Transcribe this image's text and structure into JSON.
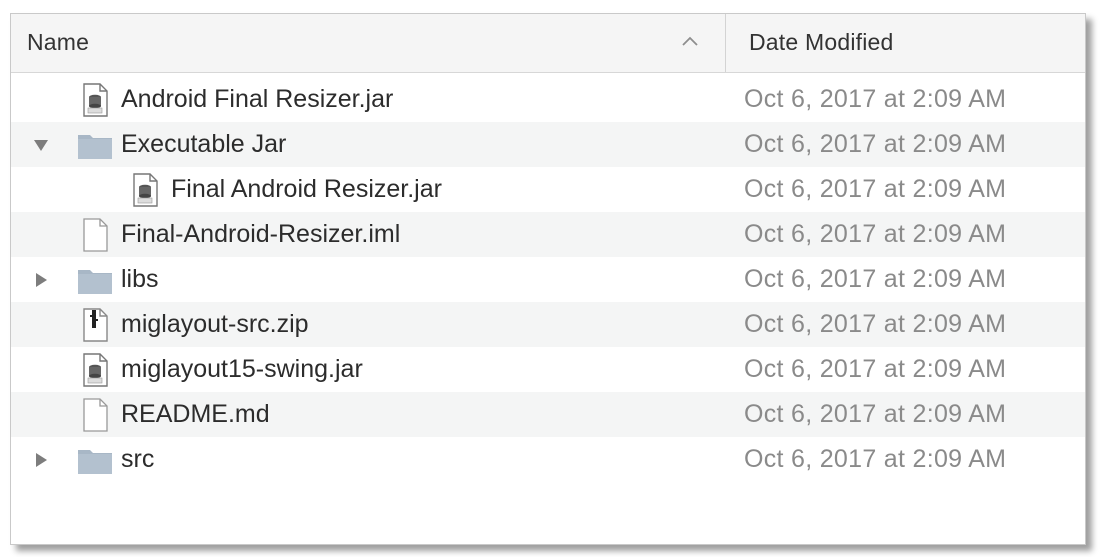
{
  "header": {
    "name_label": "Name",
    "date_label": "Date Modified"
  },
  "rows": [
    {
      "name": "Android Final Resizer.jar",
      "date": "Oct 6, 2017 at 2:09 AM",
      "icon": "jar-icon",
      "indent": 0,
      "disclosure": "none"
    },
    {
      "name": "Executable Jar",
      "date": "Oct 6, 2017 at 2:09 AM",
      "icon": "folder-icon",
      "indent": 0,
      "disclosure": "expanded"
    },
    {
      "name": "Final Android Resizer.jar",
      "date": "Oct 6, 2017 at 2:09 AM",
      "icon": "jar-icon",
      "indent": 1,
      "disclosure": "none"
    },
    {
      "name": "Final-Android-Resizer.iml",
      "date": "Oct 6, 2017 at 2:09 AM",
      "icon": "document-icon",
      "indent": 0,
      "disclosure": "none"
    },
    {
      "name": "libs",
      "date": "Oct 6, 2017 at 2:09 AM",
      "icon": "folder-icon",
      "indent": 0,
      "disclosure": "collapsed"
    },
    {
      "name": "miglayout-src.zip",
      "date": "Oct 6, 2017 at 2:09 AM",
      "icon": "zip-icon",
      "indent": 0,
      "disclosure": "none"
    },
    {
      "name": "miglayout15-swing.jar",
      "date": "Oct 6, 2017 at 2:09 AM",
      "icon": "jar-icon",
      "indent": 0,
      "disclosure": "none"
    },
    {
      "name": "README.md",
      "date": "Oct 6, 2017 at 2:09 AM",
      "icon": "document-icon",
      "indent": 0,
      "disclosure": "none"
    },
    {
      "name": "src",
      "date": "Oct 6, 2017 at 2:09 AM",
      "icon": "folder-icon",
      "indent": 0,
      "disclosure": "collapsed"
    }
  ],
  "colors": {
    "folder": "#a8b7c6",
    "row_alt": "#f4f5f5",
    "date_text": "#8a8a8a"
  }
}
